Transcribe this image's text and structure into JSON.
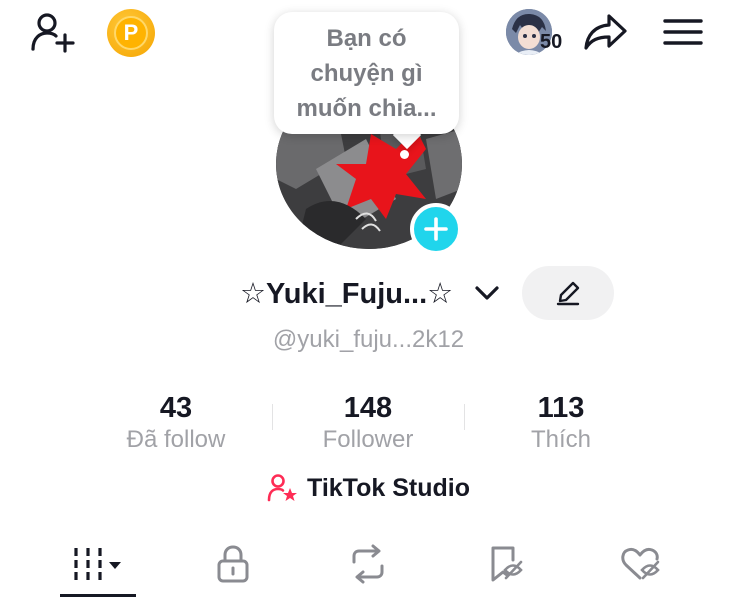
{
  "top_bar": {
    "coin_letter": "P",
    "friends_count": "50"
  },
  "profile": {
    "bubble_text": "Bạn có\nchuyện gì\nmuốn chia...",
    "display_name": "☆Yuki_Fuju...☆",
    "username": "@yuki_fuju...2k12"
  },
  "stats": [
    {
      "value": "43",
      "label": "Đã follow"
    },
    {
      "value": "148",
      "label": "Follower"
    },
    {
      "value": "113",
      "label": "Thích"
    }
  ],
  "studio": {
    "label": "TikTok Studio"
  },
  "tabs": [
    {
      "name": "videos",
      "icon": "grid-icon"
    },
    {
      "name": "private",
      "icon": "lock-icon"
    },
    {
      "name": "reposts",
      "icon": "repost-icon"
    },
    {
      "name": "favorites",
      "icon": "bookmark-icon"
    },
    {
      "name": "liked",
      "icon": "heart-icon"
    }
  ],
  "colors": {
    "accent_cyan": "#20d5ec",
    "studio_pink": "#fe2c55",
    "coin_gold": "#ffb300",
    "muted_text": "#a1a2a7"
  }
}
